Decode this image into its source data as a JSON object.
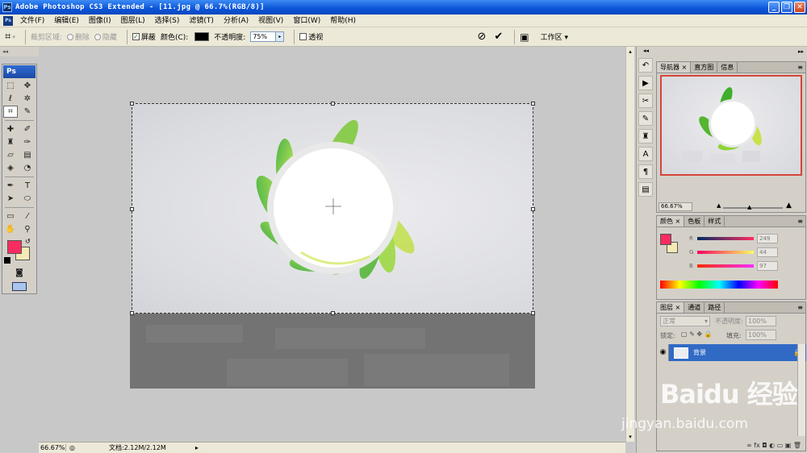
{
  "window": {
    "title": "Adobe Photoshop CS3 Extended - [11.jpg @ 66.7%(RGB/8)]",
    "app_icon": "Ps",
    "minimize": "_",
    "restore": "❐",
    "close": "✕"
  },
  "menu": {
    "items": [
      "文件(F)",
      "编辑(E)",
      "图像(I)",
      "图层(L)",
      "选择(S)",
      "滤镜(T)",
      "分析(A)",
      "视图(V)",
      "窗口(W)",
      "帮助(H)"
    ]
  },
  "options": {
    "crop_region_label": "裁剪区域:",
    "delete_label": "删除",
    "hide_label": "隐藏",
    "shield_label": "屏蔽",
    "shield_checked": "✓",
    "color_label": "颜色(C):",
    "shield_color": "#000000",
    "opacity_label": "不透明度:",
    "opacity_value": "75%",
    "perspective_label": "透视",
    "workspace_label": "工作区 ▾"
  },
  "toolbox": {
    "logo": "Ps",
    "collapse": "◂◂",
    "foreground_color": "#f92c61",
    "background_color": "#f4eab6"
  },
  "status": {
    "zoom": "66.67%",
    "doc_info": "文档:2.12M/2.12M"
  },
  "navigator": {
    "tabs": [
      "导航器",
      "直方图",
      "信息"
    ],
    "zoom": "66.67%"
  },
  "color_panel": {
    "tabs": [
      "颜色",
      "色板",
      "样式"
    ],
    "r_label": "R",
    "g_label": "G",
    "b_label": "B",
    "r": "249",
    "g": "44",
    "b": "97"
  },
  "layers_panel": {
    "tabs": [
      "图层",
      "通道",
      "路径"
    ],
    "blend_mode": "正常",
    "opacity_label": "不透明度:",
    "opacity_value": "100%",
    "lock_label": "锁定:",
    "fill_label": "填充:",
    "fill_value": "100%",
    "layer_name": "背景",
    "footer_icons": "∞ fx ◘ ◐ ▭ ▣ 🗑"
  },
  "watermark": {
    "brand": "Baidu 经验",
    "url": "jingyan.baidu.com"
  }
}
